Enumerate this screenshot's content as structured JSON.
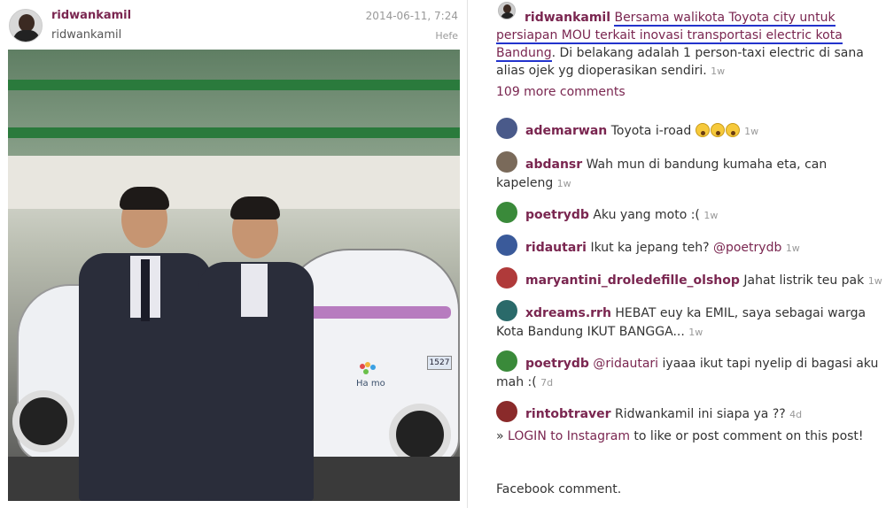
{
  "post": {
    "username": "ridwankamil",
    "fullname": "ridwankamil",
    "date": "2014-06-11, 7:24",
    "filter": "Hefe",
    "plate_text": "1527",
    "car_logo": "Ha mo"
  },
  "caption": {
    "username": "ridwankamil",
    "highlight": "Bersama walikota Toyota city untuk persiapan MOU terkait inovasi transportasi electric kota Bandung",
    "rest": ". Di belakang adalah 1 person-taxi electric di sana alias ojek yg dioperasikan sendiri.",
    "age": "1w"
  },
  "more_comments": "109 more comments",
  "comments": [
    {
      "user": "ademarwan",
      "text": "Toyota i-road",
      "emoji_count": 3,
      "age": "1w",
      "avatar_color": "#4a5a8a"
    },
    {
      "user": "abdansr",
      "text": "Wah mun di bandung kumaha eta, can kapeleng",
      "age": "1w",
      "avatar_color": "#7a6a5a"
    },
    {
      "user": "poetrydb",
      "text": "Aku yang moto :(",
      "age": "1w",
      "avatar_color": "#3a8a3a"
    },
    {
      "user": "ridautari",
      "text": "Ikut ka jepang teh?",
      "mention": "@poetrydb",
      "age": "1w",
      "avatar_color": "#3a5a9a"
    },
    {
      "user": "maryantini_droledefille_olshop",
      "text": "Jahat listrik teu pak",
      "age": "1w",
      "avatar_color": "#b03a3a"
    },
    {
      "user": "xdreams.rrh",
      "text": "HEBAT euy ka EMIL, saya sebagai warga Kota Bandung IKUT BANGGA...",
      "age": "1w",
      "avatar_color": "#2a6a6a"
    },
    {
      "user": "poetrydb",
      "mention": "@ridautari",
      "text": "iyaaa ikut tapi nyelip di bagasi aku mah :(",
      "age": "7d",
      "avatar_color": "#3a8a3a"
    },
    {
      "user": "rintobtraver",
      "text": "Ridwankamil ini siapa ya ??",
      "age": "4d",
      "avatar_color": "#8a2a2a"
    }
  ],
  "login": {
    "prefix": "» ",
    "link": "LOGIN to Instagram",
    "suffix": " to like or post comment on this post!"
  },
  "facebook": "Facebook comment.",
  "colors": {
    "username": "#7a2650",
    "highlight_underline": "#2233cc",
    "meta": "#999999"
  }
}
